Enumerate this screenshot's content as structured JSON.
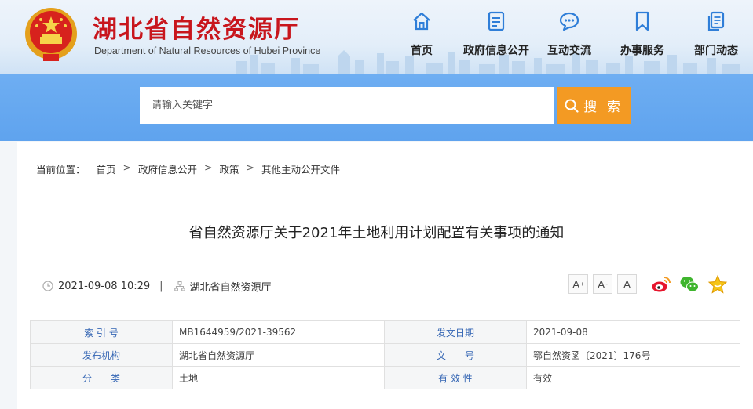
{
  "header": {
    "site_title": "湖北省自然资源厅",
    "site_subtitle": "Department of Natural Resources of Hubei Province",
    "nav": [
      {
        "label": "首页",
        "icon": "home-icon"
      },
      {
        "label": "政府信息公开",
        "icon": "document-icon"
      },
      {
        "label": "互动交流",
        "icon": "chat-bubble-icon"
      },
      {
        "label": "办事服务",
        "icon": "bookmark-icon"
      },
      {
        "label": "部门动态",
        "icon": "copy-document-icon"
      }
    ]
  },
  "search": {
    "placeholder": "请输入关键字",
    "button_label": "搜 索"
  },
  "breadcrumb": {
    "label": "当前位置：",
    "items": [
      "首页",
      "政府信息公开",
      "政策",
      "其他主动公开文件"
    ]
  },
  "article": {
    "title": "省自然资源厅关于2021年土地利用计划配置有关事项的通知",
    "datetime": "2021-09-08 10:29",
    "source": "湖北省自然资源厅",
    "font_buttons": [
      "A",
      "A",
      "A"
    ]
  },
  "share": [
    {
      "name": "weibo",
      "icon": "weibo-icon"
    },
    {
      "name": "wechat",
      "icon": "wechat-icon"
    },
    {
      "name": "favorite",
      "icon": "star-icon"
    }
  ],
  "info_table": {
    "rows": [
      {
        "k1": "索 引 号",
        "v1": "MB1644959/2021-39562",
        "k2": "发文日期",
        "v2": "2021-09-08"
      },
      {
        "k1": "发布机构",
        "v1": "湖北省自然资源厅",
        "k2": "文　　号",
        "v2": "鄂自然资函〔2021〕176号"
      },
      {
        "k1": "分　　类",
        "v1": "土地",
        "k2": "有 效 性",
        "v2": "有效"
      }
    ]
  },
  "colors": {
    "brand_red": "#c8161d",
    "band_blue": "#6aaaf0",
    "search_orange": "#f39a23",
    "nav_icon_blue": "#2f7ed8",
    "table_key": "#3566b4"
  }
}
